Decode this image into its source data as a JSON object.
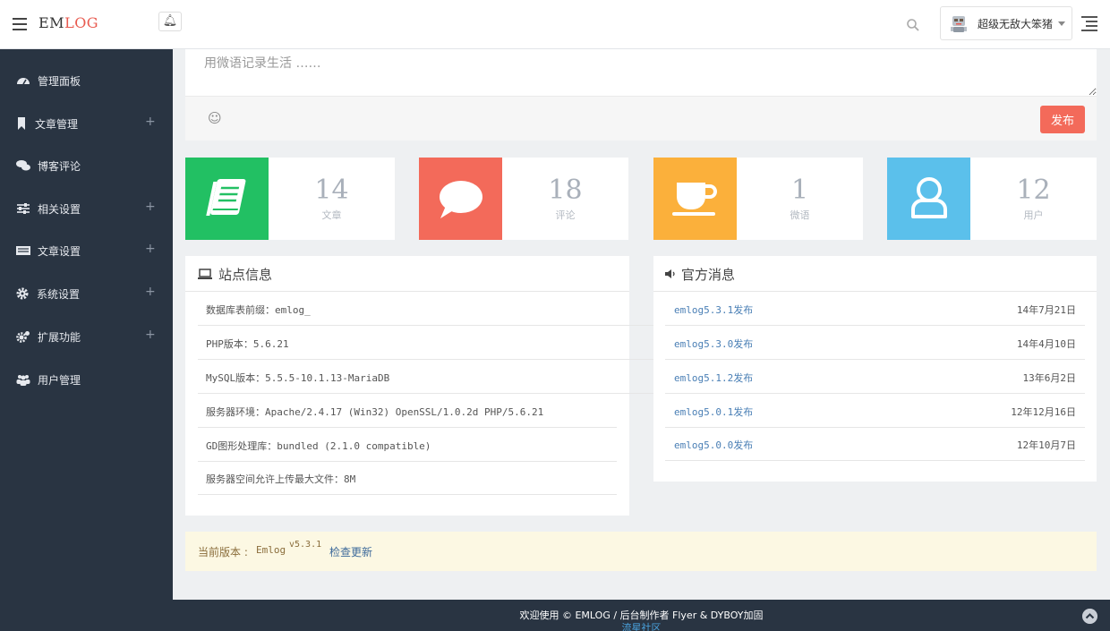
{
  "header": {
    "logo_main": "EM",
    "logo_accent": "LOG",
    "username": "超级无敌大笨猪"
  },
  "sidebar": {
    "items": [
      {
        "label": "管理面板",
        "expandable": false
      },
      {
        "label": "文章管理",
        "expandable": true
      },
      {
        "label": "博客评论",
        "expandable": false
      },
      {
        "label": "相关设置",
        "expandable": true
      },
      {
        "label": "文章设置",
        "expandable": true
      },
      {
        "label": "系统设置",
        "expandable": true
      },
      {
        "label": "扩展功能",
        "expandable": true
      },
      {
        "label": "用户管理",
        "expandable": false
      }
    ],
    "plus": "+"
  },
  "composer": {
    "placeholder": "用微语记录生活 ……",
    "emoji": "☺",
    "publish_label": "发布"
  },
  "stats": [
    {
      "value": "14",
      "label": "文章",
      "color": "#22c063",
      "icon": "book-icon"
    },
    {
      "value": "18",
      "label": "评论",
      "color": "#f36a5a",
      "icon": "speech-bubble-icon"
    },
    {
      "value": "1",
      "label": "微语",
      "color": "#fbb03b",
      "icon": "coffee-cup-icon"
    },
    {
      "value": "12",
      "label": "用户",
      "color": "#5bc0eb",
      "icon": "user-icon"
    }
  ],
  "site_info": {
    "title": "站点信息",
    "rows": [
      "数据库表前缀：emlog_",
      "PHP版本：5.6.21",
      "MySQL版本：5.5.5-10.1.13-MariaDB",
      "服务器环境：Apache/2.4.17 (Win32) OpenSSL/1.0.2d PHP/5.6.21",
      "GD图形处理库：bundled (2.1.0 compatible)",
      "服务器空间允许上传最大文件：8M"
    ]
  },
  "news": {
    "title": "官方消息",
    "items": [
      {
        "title": "emlog5.3.1发布",
        "date": "14年7月21日"
      },
      {
        "title": "emlog5.3.0发布",
        "date": "14年4月10日"
      },
      {
        "title": "emlog5.1.2发布",
        "date": "13年6月2日"
      },
      {
        "title": "emlog5.0.1发布",
        "date": "12年12月16日"
      },
      {
        "title": "emlog5.0.0发布",
        "date": "12年10月7日"
      }
    ]
  },
  "version": {
    "label": "当前版本 :",
    "name": "Emlog",
    "number": "v5.3.1",
    "check_label": "检查更新"
  },
  "footer": {
    "text": "欢迎使用 © EMLOG / 后台制作者 Flyer & DYBOY加固",
    "link": "流星社区"
  }
}
